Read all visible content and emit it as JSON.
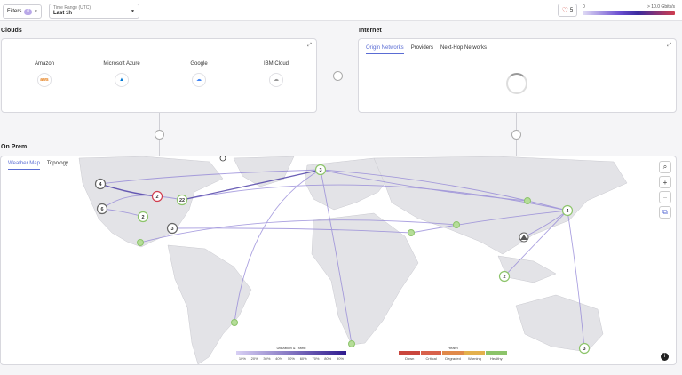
{
  "topbar": {
    "filters_label": "Filters",
    "filters_count": "0",
    "time_range_label": "Time Range (UTC)",
    "time_range_value": "Last 1h",
    "alerts_count": "5",
    "legend_min": "0",
    "legend_max": "> 10.0 Gbits/s"
  },
  "clouds": {
    "title": "Clouds",
    "items": [
      {
        "label": "Amazon",
        "logo": "aws"
      },
      {
        "label": "Microsoft Azure",
        "logo": "azure-icon"
      },
      {
        "label": "Google",
        "logo": "google-cloud-icon"
      },
      {
        "label": "IBM Cloud",
        "logo": "cloud-icon"
      }
    ]
  },
  "internet": {
    "title": "Internet",
    "tabs": [
      "Origin Networks",
      "Providers",
      "Next-Hop Networks"
    ],
    "active_tab": "Origin Networks"
  },
  "onprem": {
    "title": "On Prem",
    "tabs": [
      "Weather Map",
      "Topology"
    ],
    "active_tab": "Weather Map",
    "nodes": [
      {
        "label": "4"
      },
      {
        "label": "6"
      },
      {
        "label": "2"
      },
      {
        "label": "22"
      },
      {
        "label": "2"
      },
      {
        "label": "3"
      },
      {
        "label": "3"
      },
      {
        "label": "4"
      },
      {
        "label": "2"
      },
      {
        "label": "3"
      }
    ],
    "utilization_legend": {
      "title": "Utilization & Traffic",
      "ticks": [
        "10%",
        "20%",
        "30%",
        "40%",
        "50%",
        "60%",
        "70%",
        "80%",
        "90%"
      ]
    },
    "health_legend": {
      "title": "Health",
      "items": [
        {
          "label": "Down",
          "color": "#c9463d"
        },
        {
          "label": "Critical",
          "color": "#d8614b"
        },
        {
          "label": "Degraded",
          "color": "#e0894a"
        },
        {
          "label": "Warning",
          "color": "#e3b04c"
        },
        {
          "label": "Healthy",
          "color": "#8cc46a"
        }
      ]
    }
  },
  "colors": {
    "accent": "#5a6cd4",
    "link": "#8f82d6",
    "node_healthy": "#8cc46a"
  }
}
